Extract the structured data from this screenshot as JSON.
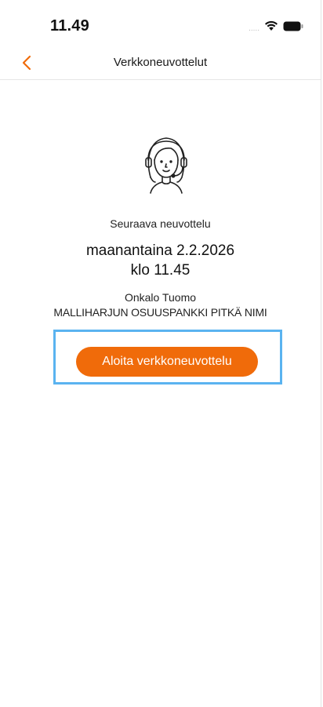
{
  "status_bar": {
    "time": "11.49",
    "signal_dots": "....."
  },
  "nav": {
    "title": "Verkkoneuvottelut",
    "back_icon": "chevron-left-icon",
    "accent_color": "#f06b0a"
  },
  "meeting": {
    "avatar_icon": "advisor-headset-icon",
    "label": "Seuraava neuvottelu",
    "date": "maanantaina 2.2.2026",
    "time": "klo 11.45",
    "advisor_name": "Onkalo Tuomo",
    "bank_name": "MALLIHARJUN OSUUSPANKKI PITKÄ NIMI"
  },
  "actions": {
    "start_label": "Aloita verkkoneuvottelu",
    "button_color": "#f06b0a",
    "highlight_color": "#5ab3f0"
  }
}
